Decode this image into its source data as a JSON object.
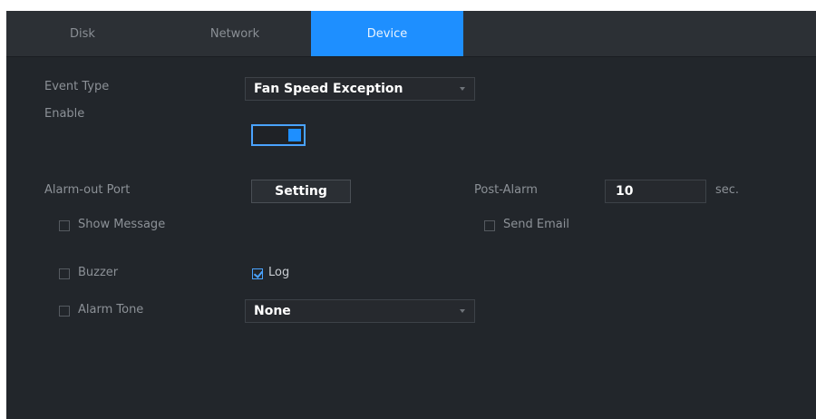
{
  "tabs": [
    {
      "label": "Disk"
    },
    {
      "label": "Network"
    },
    {
      "label": "Device"
    }
  ],
  "event_type": {
    "label": "Event Type",
    "value": "Fan Speed Exception"
  },
  "enable": {
    "label": "Enable",
    "on": true
  },
  "alarm_out": {
    "label": "Alarm-out Port",
    "button": "Setting"
  },
  "post_alarm": {
    "label": "Post-Alarm",
    "value": "10",
    "unit": "sec."
  },
  "show_message": {
    "label": "Show Message",
    "checked": false
  },
  "send_email": {
    "label": "Send Email",
    "checked": false
  },
  "buzzer": {
    "label": "Buzzer",
    "checked": false
  },
  "log": {
    "label": "Log",
    "checked": true
  },
  "alarm_tone": {
    "label": "Alarm Tone",
    "checked": false,
    "value": "None"
  },
  "colors": {
    "accent": "#1e8fff",
    "background": "#22262b",
    "tabbar": "#2c3035"
  }
}
